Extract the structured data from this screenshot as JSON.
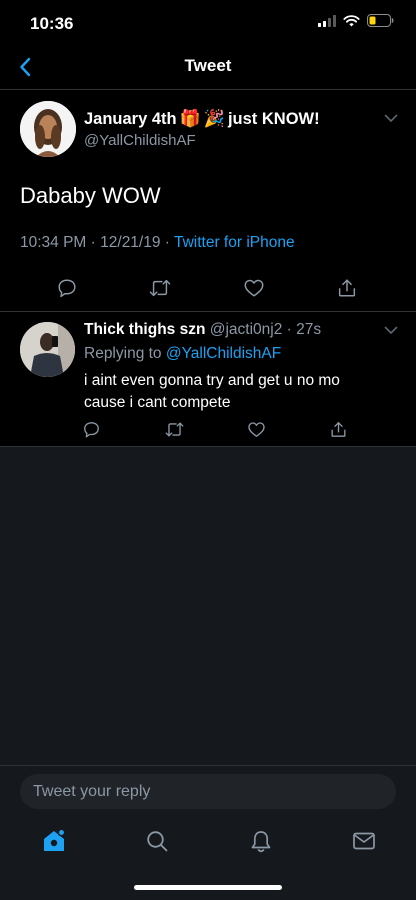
{
  "status_bar": {
    "time": "10:36"
  },
  "nav": {
    "title": "Tweet"
  },
  "main_tweet": {
    "author_name": "January 4th",
    "author_name_suffix": "just KNOW!",
    "emojis": [
      "🎁",
      "🎉"
    ],
    "handle": "@YallChildishAF",
    "text": "Dababy WOW",
    "time": "10:34 PM",
    "date": "12/21/19",
    "separator": " · ",
    "source": "Twitter for iPhone"
  },
  "reply_tweet": {
    "name": "Thick thighs szn",
    "handle": "@jacti0nj2",
    "time_ago": "27s",
    "replying_to_prefix": "Replying to",
    "replying_to_handle": "@YallChildishAF",
    "text": "i aint even gonna try and get u no mo cause i cant compete"
  },
  "reply_bar": {
    "placeholder": "Tweet your reply"
  },
  "colors": {
    "accent": "#1da1f2",
    "secondary_text": "#8b98a5",
    "background": "#000000",
    "surface": "#15181c"
  },
  "icons": [
    "back-chevron-icon",
    "signal-icon",
    "wifi-icon",
    "battery-icon",
    "chevron-down-icon",
    "reply-icon",
    "retweet-icon",
    "like-icon",
    "share-icon",
    "home-icon",
    "search-icon",
    "notifications-icon",
    "messages-icon"
  ]
}
